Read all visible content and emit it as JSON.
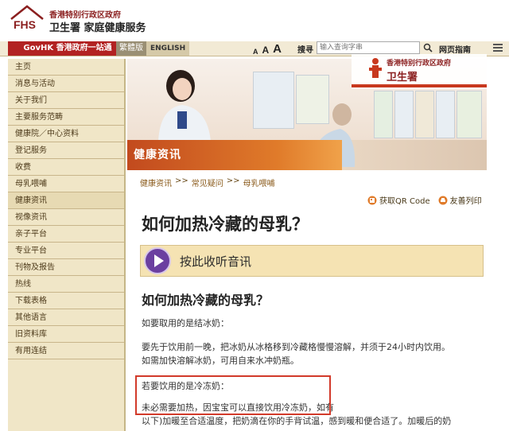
{
  "header": {
    "title_line_1": "香港特别行政区政府",
    "title_line_2": "卫生署 家庭健康服务",
    "logo_text": "FHS"
  },
  "navbar": {
    "govhk": "GovHK 香港政府一站通",
    "lang_tc": "繁體版",
    "lang_en": "ENGLISH",
    "font_sizes": [
      "A",
      "A",
      "A"
    ],
    "search_label": "搜寻",
    "search_placeholder": "输入查询字串",
    "guide": "网页指南"
  },
  "sidebar": {
    "items": [
      {
        "label": "主页"
      },
      {
        "label": "消息与活动"
      },
      {
        "label": "关于我们"
      },
      {
        "label": "主要服务范畴"
      },
      {
        "label": "健康院／中心资料"
      },
      {
        "label": "登记服务"
      },
      {
        "label": "收费"
      },
      {
        "label": "母乳喂哺"
      },
      {
        "label": "健康资讯"
      },
      {
        "label": "视像资讯"
      },
      {
        "label": "亲子平台"
      },
      {
        "label": "专业平台"
      },
      {
        "label": "刊物及报告"
      },
      {
        "label": "热线"
      },
      {
        "label": "下载表格"
      },
      {
        "label": "其他语言"
      },
      {
        "label": "旧资料库"
      },
      {
        "label": "有用连结"
      }
    ]
  },
  "banner": {
    "section": "健康资讯",
    "dh_line_1": "香港特别行政区政府",
    "dh_line_2": "卫生署"
  },
  "breadcrumb": [
    "健康资讯",
    "常见疑问",
    "母乳喂哺"
  ],
  "breadcrumb_sep": ">>",
  "tools": {
    "qr": "获取QR Code",
    "print": "友善列印"
  },
  "main": {
    "page_title": "如何加热冷藏的母乳？",
    "audio_label": "按此收听音讯",
    "section_title": "如何加热冷藏的母乳？",
    "p1": "如要取用的是结冰奶：",
    "p2": "要先于饮用前一晚，把冰奶从冰格移到冷藏格慢慢溶解，并须于24小时内饮用。",
    "p3": "如需加快溶解冰奶，可用自来水冲奶瓶。",
    "p4": "若要饮用的是冷冻奶：",
    "p5": "未必需要加热，因宝宝可以直接饮用冷冻奶，如有",
    "p6": "以下)加暖至合适温度，把奶滴在你的手背试温，感到暖和便合适了。加暖后的奶"
  },
  "colors": {
    "govhk_red": "#b22222",
    "sidebar_bg": "#f0e6c7",
    "banner_orange": "#c24a1e",
    "highlight_red": "#d23a2a",
    "audio_purple": "#6b3fa0"
  }
}
